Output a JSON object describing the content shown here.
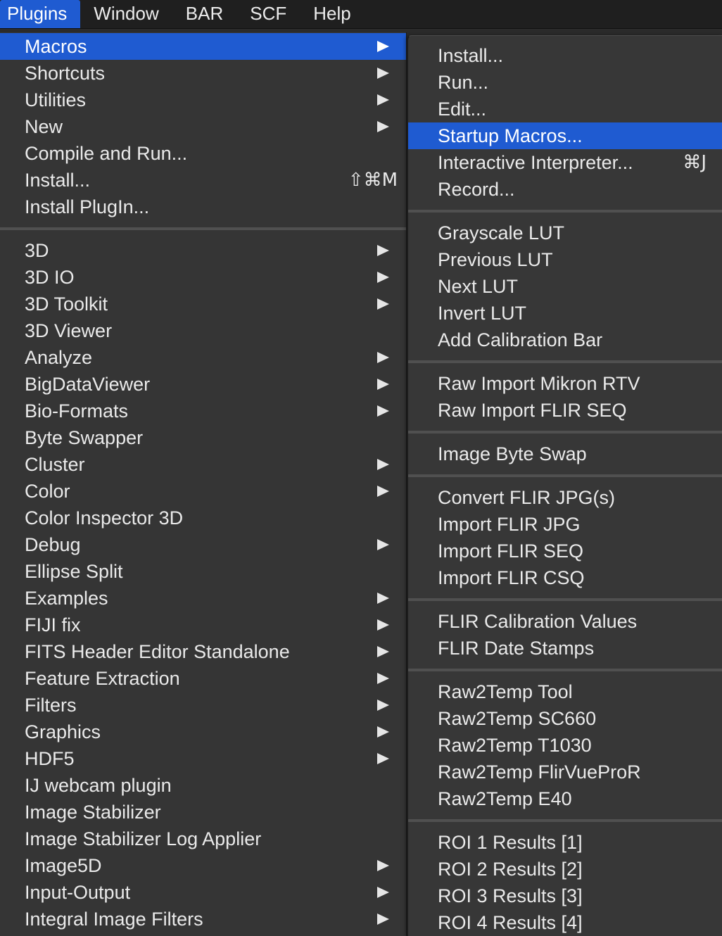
{
  "menubar": {
    "items": [
      "Plugins",
      "Window",
      "BAR",
      "SCF",
      "Help"
    ]
  },
  "plugins_menu": {
    "items": [
      {
        "label": "Macros",
        "submenu": true,
        "selected": true
      },
      {
        "label": "Shortcuts",
        "submenu": true
      },
      {
        "label": "Utilities",
        "submenu": true
      },
      {
        "label": "New",
        "submenu": true
      },
      {
        "label": "Compile and Run...",
        "submenu": false
      },
      {
        "label": "Install...",
        "submenu": false,
        "shortcut": "⇧⌘M"
      },
      {
        "label": "Install PlugIn...",
        "submenu": false
      },
      {
        "separator": true
      },
      {
        "label": "3D",
        "submenu": true
      },
      {
        "label": "3D IO",
        "submenu": true
      },
      {
        "label": "3D Toolkit",
        "submenu": true
      },
      {
        "label": "3D Viewer",
        "submenu": false
      },
      {
        "label": "Analyze",
        "submenu": true
      },
      {
        "label": "BigDataViewer",
        "submenu": true
      },
      {
        "label": "Bio-Formats",
        "submenu": true
      },
      {
        "label": "Byte Swapper",
        "submenu": false
      },
      {
        "label": "Cluster",
        "submenu": true
      },
      {
        "label": "Color",
        "submenu": true
      },
      {
        "label": "Color Inspector 3D",
        "submenu": false
      },
      {
        "label": "Debug",
        "submenu": true
      },
      {
        "label": "Ellipse Split",
        "submenu": false
      },
      {
        "label": "Examples",
        "submenu": true
      },
      {
        "label": "FIJI fix",
        "submenu": true
      },
      {
        "label": "FITS Header Editor Standalone",
        "submenu": true
      },
      {
        "label": "Feature Extraction",
        "submenu": true
      },
      {
        "label": "Filters",
        "submenu": true
      },
      {
        "label": "Graphics",
        "submenu": true
      },
      {
        "label": "HDF5",
        "submenu": true
      },
      {
        "label": "IJ webcam plugin",
        "submenu": false
      },
      {
        "label": "Image Stabilizer",
        "submenu": false
      },
      {
        "label": "Image Stabilizer Log Applier",
        "submenu": false
      },
      {
        "label": "Image5D",
        "submenu": true
      },
      {
        "label": "Input-Output",
        "submenu": true
      },
      {
        "label": "Integral Image Filters",
        "submenu": true
      }
    ]
  },
  "macros_submenu": {
    "items": [
      {
        "label": "Install..."
      },
      {
        "label": "Run..."
      },
      {
        "label": "Edit..."
      },
      {
        "label": "Startup Macros...",
        "selected": true
      },
      {
        "label": "Interactive Interpreter...",
        "shortcut": "⌘J"
      },
      {
        "label": "Record..."
      },
      {
        "separator": true
      },
      {
        "label": "Grayscale LUT"
      },
      {
        "label": "Previous LUT"
      },
      {
        "label": "Next LUT"
      },
      {
        "label": "Invert LUT"
      },
      {
        "label": "Add Calibration Bar"
      },
      {
        "separator": true
      },
      {
        "label": "Raw Import Mikron RTV"
      },
      {
        "label": "Raw Import FLIR SEQ"
      },
      {
        "separator": true
      },
      {
        "label": "Image Byte Swap"
      },
      {
        "separator": true
      },
      {
        "label": "Convert FLIR JPG(s)"
      },
      {
        "label": "Import FLIR JPG"
      },
      {
        "label": "Import FLIR SEQ"
      },
      {
        "label": "Import FLIR CSQ"
      },
      {
        "separator": true
      },
      {
        "label": "FLIR Calibration Values"
      },
      {
        "label": "FLIR Date Stamps"
      },
      {
        "separator": true
      },
      {
        "label": "Raw2Temp Tool"
      },
      {
        "label": "Raw2Temp SC660"
      },
      {
        "label": "Raw2Temp T1030"
      },
      {
        "label": "Raw2Temp FlirVueProR"
      },
      {
        "label": "Raw2Temp E40"
      },
      {
        "separator": true
      },
      {
        "label": "ROI 1 Results [1]"
      },
      {
        "label": "ROI 2 Results [2]"
      },
      {
        "label": "ROI 3 Results [3]"
      },
      {
        "label": "ROI 4 Results [4]"
      }
    ]
  },
  "colors": {
    "selection": "#1f5bd1",
    "menu_bg": "#353535",
    "text": "#eaeaea"
  },
  "icons": {
    "submenu_arrow": "submenu-arrow-icon"
  }
}
